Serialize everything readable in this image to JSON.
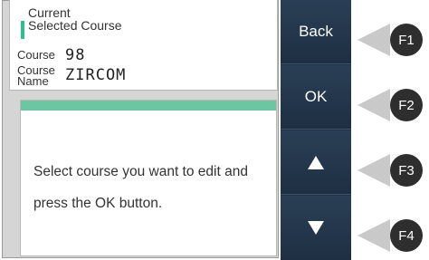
{
  "info": {
    "current_label": "Current\nSelected Course",
    "course_label": "Course",
    "course_value": "98",
    "name_label": "Course\nName",
    "name_value": "ZIRCOM"
  },
  "message": {
    "text": "Select course you want to edit and press the OK button."
  },
  "side_buttons": {
    "back_label": "Back",
    "ok_label": "OK",
    "up_icon": "triangle-up-icon",
    "down_icon": "triangle-down-icon"
  },
  "function_keys": [
    "F1",
    "F2",
    "F3",
    "F4"
  ],
  "colors": {
    "panel_dark": "#213347",
    "accent_green": "#2fbf8a",
    "fkey_circle": "#2e2e2e",
    "fkey_arrow": "#c9c9c9"
  }
}
